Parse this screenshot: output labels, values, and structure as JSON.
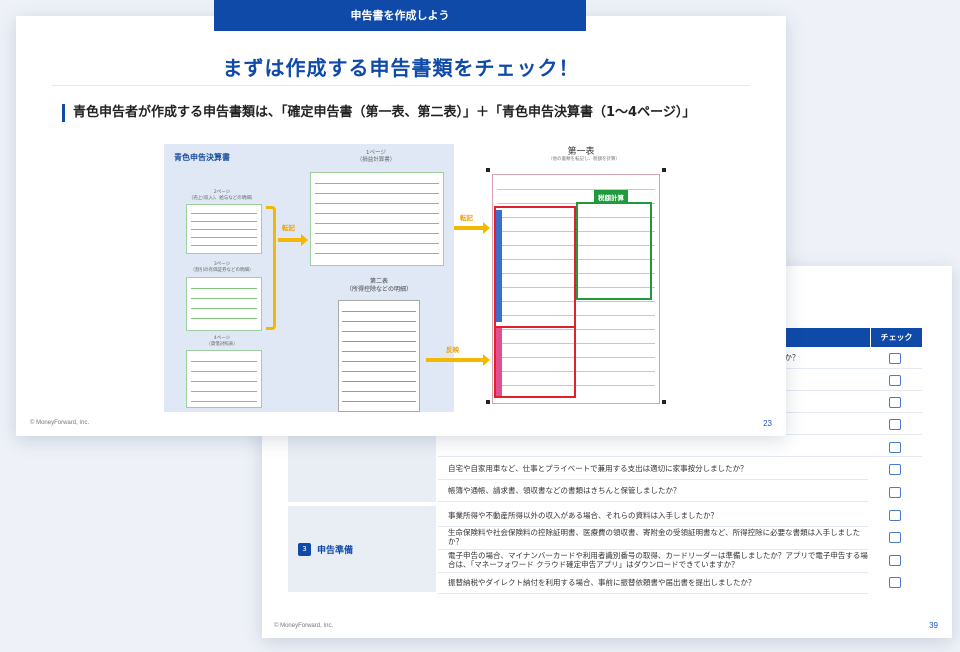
{
  "back_slide": {
    "header_check": "チェック",
    "rows": [
      "を提出しましたか？",
      "",
      "？",
      "",
      "",
      "自宅や自家用車など、仕事とプライベートで兼用する支出は適切に家事按分しましたか？",
      "帳簿や通帳、請求書、領収書などの書類はきちんと保管しましたか？",
      "事業所得や不動産所得以外の収入がある場合、それらの資料は入手しましたか？",
      "生命保険料や社会保険料の控除証明書、医療費の領収書、寄附金の受領証明書など、所得控除に必要な書類は入手しましたか？",
      "電子申告の場合、マイナンバーカードや利用者識別番号の取得、カードリーダーは準備しましたか？アプリで電子申告する場合は、「マネーフォワード クラウド確定申告アプリ」はダウンロードできていますか？",
      "振替納税やダイレクト納付を利用する場合、事前に振替依頼書や届出書を提出しましたか？"
    ],
    "category_number": "3",
    "category_label": "申告準備",
    "copyright": "© MoneyForward, Inc.",
    "page_number": "39"
  },
  "front_slide": {
    "tab_label": "申告書を作成しよう",
    "title": "まずは作成する申告書類をチェック！",
    "subtitle": "青色申告者が作成する申告書類は、「確定申告書（第一表、第二表）」＋「青色申告決算書（1〜4ページ）」",
    "copyright": "© MoneyForward, Inc.",
    "page_number": "23"
  },
  "figure": {
    "panel_title": "青色申告決算書",
    "page1_caption": "1ページ\n（損益計算書）",
    "page2_caption": "2ページ\n（売上(収入)、給与などの明細）",
    "page3_caption": "3ページ\n（割引の有価証券などの明細）",
    "page4_caption": "4ページ\n（貸借対照表）",
    "transfer_label_1": "転記",
    "transfer_label_2": "転記",
    "form2_title": "第二表\n（所得控除などの明細）",
    "form2_arrow_label": "反映",
    "form1_title": "第一表",
    "form1_subtitle": "（他の書類を転記し、税額を計算）",
    "tax_calc_tag": "税額計算"
  },
  "colors": {
    "brand_blue": "#0f4aa8",
    "accent_yellow": "#f5b800",
    "red_box": "#e0202a",
    "green_box": "#1f9a3c"
  }
}
